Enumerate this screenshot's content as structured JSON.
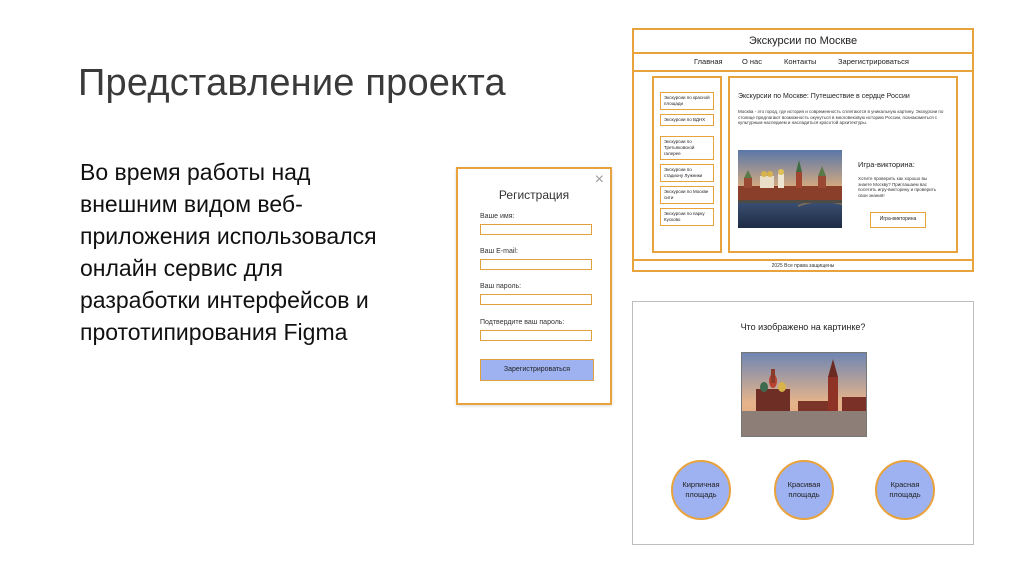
{
  "slide": {
    "title": "Представление проекта",
    "body_lines": [
      "Во время работы над",
      "внешним видом веб-",
      "приложения использовался",
      "онлайн сервис для",
      "разработки интерфейсов и",
      "прототипирования Figma"
    ]
  },
  "registration": {
    "close_icon": "×",
    "title": "Регистрация",
    "labels": [
      "Ваше имя:",
      "Ваш E-mail:",
      "Ваш пароль:",
      "Подтвердите ваш пароль:"
    ],
    "button": "Зарегистрироваться",
    "accent": "#e8a33d",
    "button_color": "#9eb1f0"
  },
  "website": {
    "header": "Экскурсии по Москве",
    "nav": [
      "Главная",
      "О нас",
      "Контакты",
      "Зарегистрироваться"
    ],
    "sidebar": [
      "Экскурсии по красной площади",
      "Экскурсии по ВДНХ",
      "Экскурсии по Третьяковской галерее",
      "Экскурсии по стадиону Лужники",
      "Экскурсии по Москве сити",
      "Экскурсии по парку Кусково"
    ],
    "heading": "Экскурсии по Москве: Путешествие в сердце России",
    "intro": "Москва - это город, где история и современность сплетаются в уникальную картину. Экскурсии по столице предлагают возможность окунуться в многовековую историю России, познакомиться с культурным наследием и насладиться красотой архитектуры.",
    "quiz_title": "Игра-викторина:",
    "quiz_text": "Хотите проверить как хорошо вы знаете Москву? Приглашаем вас посетить игру-викторину и проверить свои знания!",
    "quiz_button": "Игра-викторина",
    "footer": "2025 Все права защищены"
  },
  "quiz": {
    "question": "Что изображено на картинке?",
    "answers": [
      "Кирпичная площадь",
      "Красивая площадь",
      "Красная площадь"
    ]
  }
}
